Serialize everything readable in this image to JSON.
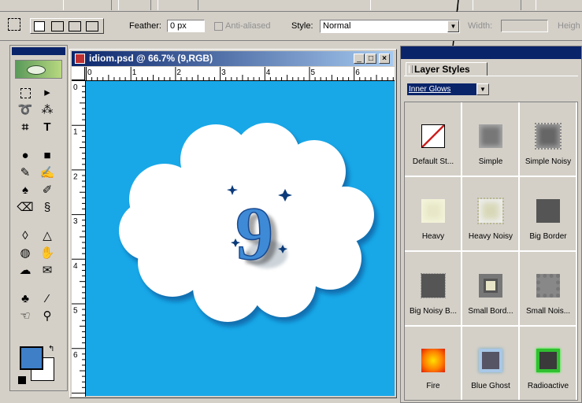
{
  "options_bar": {
    "feather_label": "Feather:",
    "feather_value": "0 px",
    "anti_aliased_label": "Anti-aliased",
    "style_label": "Style:",
    "style_value": "Normal",
    "width_label": "Width:",
    "height_label": "Heigh"
  },
  "document": {
    "title": "idiom.psd @ 66.7% (9,RGB)",
    "ruler_h": [
      "0",
      "1",
      "2",
      "3",
      "4",
      "5",
      "6"
    ],
    "ruler_v": [
      "0",
      "1",
      "2",
      "3",
      "4",
      "5",
      "6"
    ],
    "canvas_text": "9",
    "colors": {
      "canvas": "#18a8e8",
      "glyph": "#3e8ad6"
    }
  },
  "palette": {
    "tab_label": "Layer Styles",
    "category": "Inner Glows",
    "styles": [
      {
        "name": "Default St..."
      },
      {
        "name": "Simple"
      },
      {
        "name": "Simple Noisy"
      },
      {
        "name": "Heavy"
      },
      {
        "name": "Heavy Noisy"
      },
      {
        "name": "Big Border"
      },
      {
        "name": "Big Noisy B..."
      },
      {
        "name": "Small Bord..."
      },
      {
        "name": "Small Nois..."
      },
      {
        "name": "Fire"
      },
      {
        "name": "Blue Ghost"
      },
      {
        "name": "Radioactive"
      }
    ]
  },
  "toolbox": {
    "foreground_color": "#3e7fc8",
    "background_color": "#ffffff"
  }
}
